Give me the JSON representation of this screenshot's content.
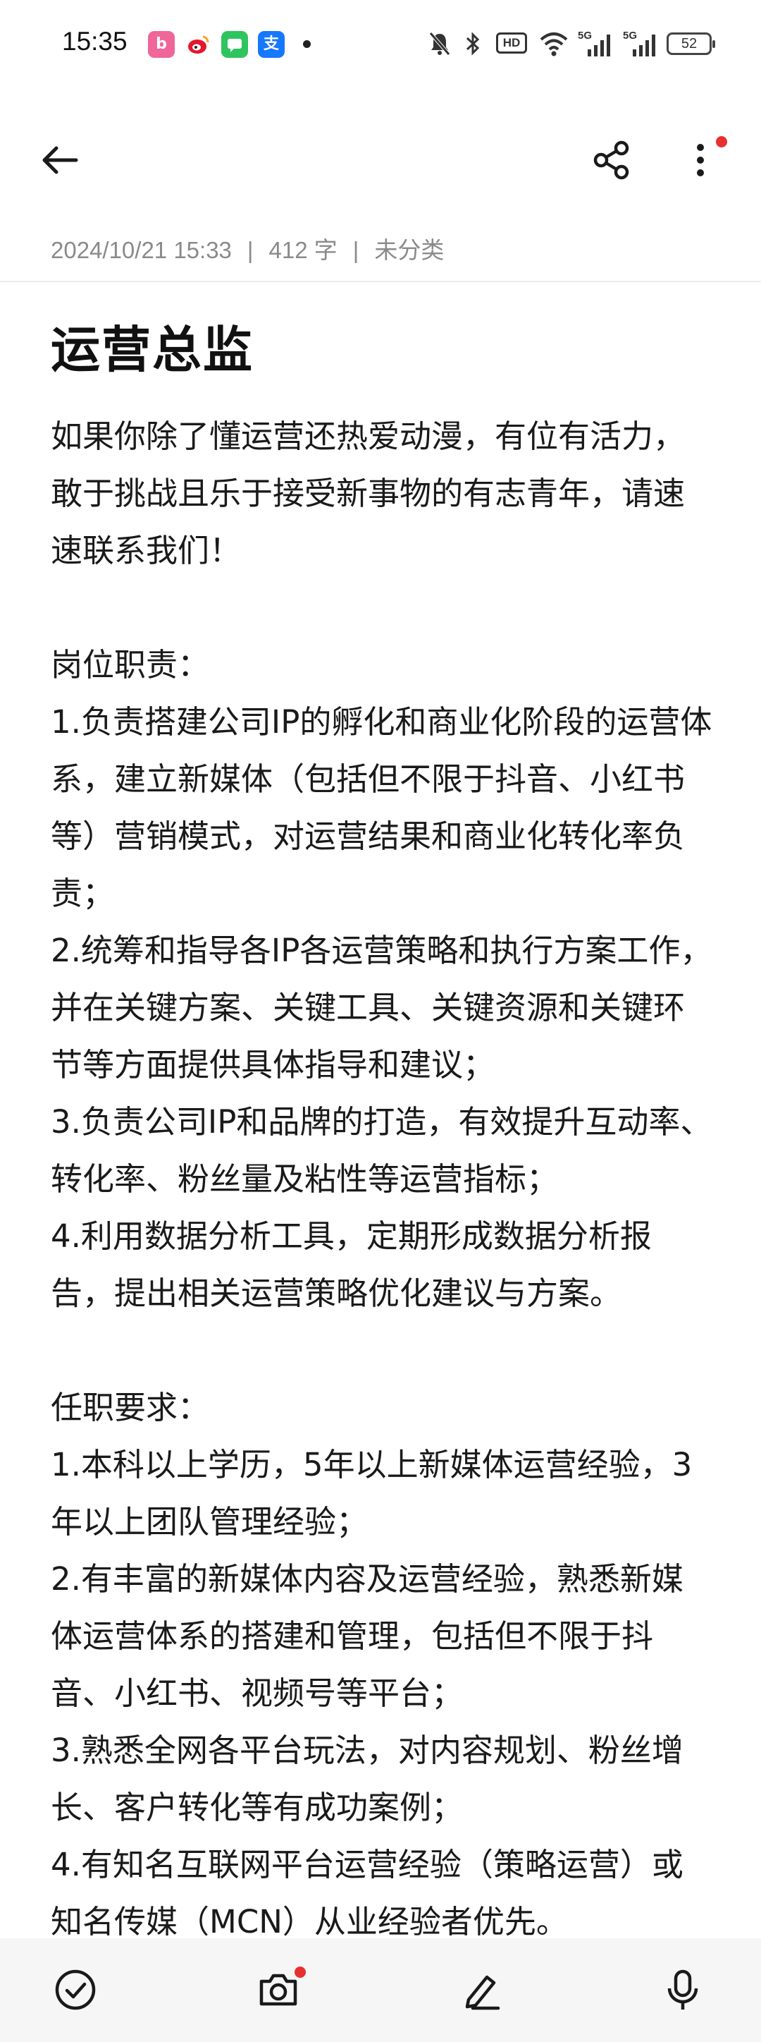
{
  "status_bar": {
    "time": "15:35",
    "notification_icons": [
      "bilibili-icon",
      "weibo-icon",
      "messages-icon",
      "alipay-icon"
    ],
    "right_icons": [
      "mute-icon",
      "bluetooth-icon",
      "hd-icon",
      "wifi-icon",
      "signal-5g-icon",
      "signal-5g-icon"
    ],
    "hd_label": "HD",
    "net_label_1": "5G",
    "net_label_2": "5G",
    "battery": "52"
  },
  "toolbar": {
    "icons": [
      "back-arrow-icon",
      "share-icon",
      "more-vertical-icon"
    ]
  },
  "meta": {
    "date": "2024/10/21 15:33",
    "word_count": "412 字",
    "category": "未分类"
  },
  "note": {
    "title": "运营总监",
    "paragraphs": [
      "如果你除了懂运营还热爱动漫，有位有活力，敢于挑战且乐于接受新事物的有志青年，请速速联系我们！",
      "",
      "岗位职责：",
      "1.负责搭建公司IP的孵化和商业化阶段的运营体系，建立新媒体（包括但不限于抖音、小红书等）营销模式，对运营结果和商业化转化率负责；",
      "2.统筹和指导各IP各运营策略和执行方案工作，并在关键方案、关键工具、关键资源和关键环节等方面提供具体指导和建议；",
      "3.负责公司IP和品牌的打造，有效提升互动率、转化率、粉丝量及粘性等运营指标；",
      "4.利用数据分析工具，定期形成数据分析报告，提出相关运营策略优化建议与方案。",
      "",
      "任职要求：",
      "1.本科以上学历，5年以上新媒体运营经验，3年以上团队管理经验；",
      "2.有丰富的新媒体内容及运营经验，熟悉新媒体运营体系的搭建和管理，包括但不限于抖音、小红书、视频号等平台；",
      "3.熟悉全网各平台玩法，对内容规划、粉丝增长、客户转化等有成功案例；",
      "4.有知名互联网平台运营经验（策略运营）或知名传媒（MCN）从业经验者优先。"
    ]
  },
  "bottom_bar": {
    "icons": [
      "checklist-icon",
      "camera-icon",
      "pen-icon",
      "microphone-icon"
    ]
  },
  "colors": {
    "badge_red": "#e8302f",
    "meta_gray": "#8a8a8a",
    "text": "#1a1a1a"
  }
}
